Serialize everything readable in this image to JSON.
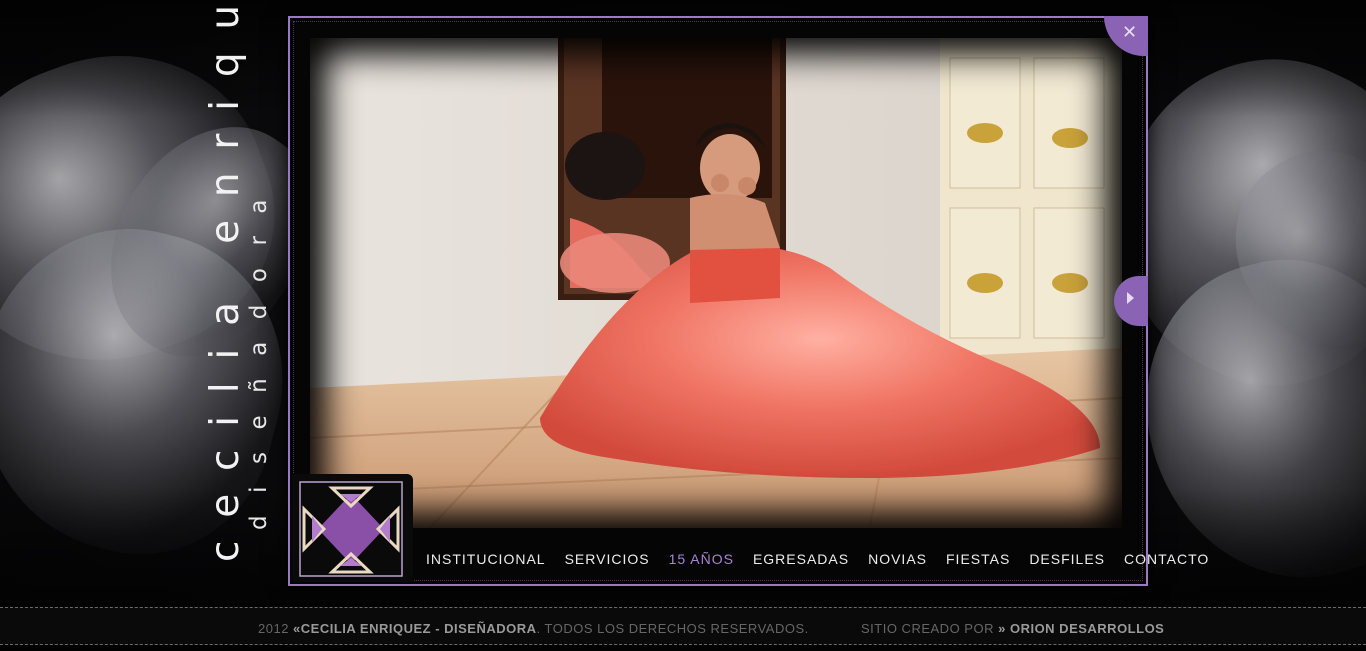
{
  "brand": {
    "name": "cecilia enriquez",
    "subtitle": "diseñadora"
  },
  "controls": {
    "close_icon": "close-icon",
    "next_icon": "chevron-right-icon"
  },
  "nav": {
    "items": [
      {
        "label": "INSTITUCIONAL",
        "active": false
      },
      {
        "label": "SERVICIOS",
        "active": false
      },
      {
        "label": "15 AÑOS",
        "active": true
      },
      {
        "label": "EGRESADAS",
        "active": false
      },
      {
        "label": "NOVIAS",
        "active": false
      },
      {
        "label": "FIESTAS",
        "active": false
      },
      {
        "label": "DESFILES",
        "active": false
      },
      {
        "label": "CONTACTO",
        "active": false
      }
    ]
  },
  "footer": {
    "year": "2012",
    "prefix": "«",
    "company": "CECILIA ENRIQUEZ - DISEÑADORA",
    "rights": ". TODOS LOS DERECHOS RESERVADOS.",
    "credit_label": "SITIO CREADO POR",
    "credit_sep": "»",
    "credit_name": "ORION DESARROLLOS"
  },
  "colors": {
    "accent": "#8a63b5",
    "frame_border": "#9a7bc2",
    "nav_active": "#a883d6",
    "dress": "#e8604e"
  }
}
